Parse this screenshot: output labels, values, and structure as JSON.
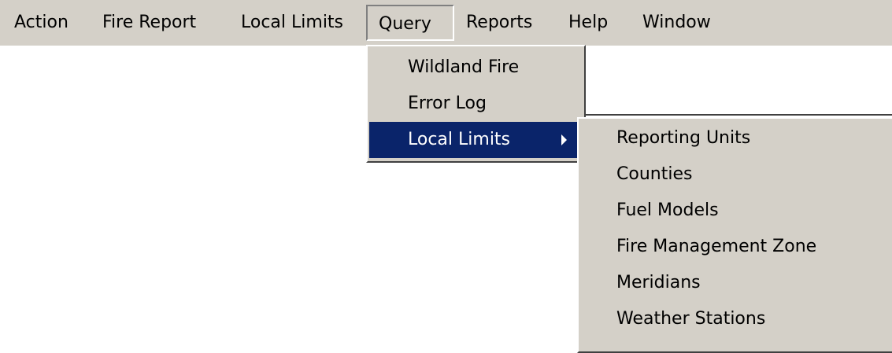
{
  "menubar": {
    "items": [
      {
        "label": "Action"
      },
      {
        "label": "Fire Report"
      },
      {
        "label": "Local Limits"
      },
      {
        "label": "Query"
      },
      {
        "label": "Reports"
      },
      {
        "label": "Help"
      },
      {
        "label": "Window"
      }
    ],
    "open_item": "Query"
  },
  "query_menu": {
    "items": [
      {
        "label": "Wildland Fire"
      },
      {
        "label": "Error Log"
      },
      {
        "label": "Local Limits",
        "has_submenu": true,
        "selected": true
      }
    ]
  },
  "local_limits_submenu": {
    "items": [
      {
        "label": "Reporting Units"
      },
      {
        "label": "Counties"
      },
      {
        "label": "Fuel Models"
      },
      {
        "label": "Fire Management Zone"
      },
      {
        "label": "Meridians"
      },
      {
        "label": "Weather Stations"
      }
    ]
  },
  "colors": {
    "menu_background": "#d4d0c8",
    "highlight_background": "#0a246a",
    "highlight_text": "#ffffff"
  },
  "icons": {
    "submenu_indicator": "triangle-right-icon"
  }
}
